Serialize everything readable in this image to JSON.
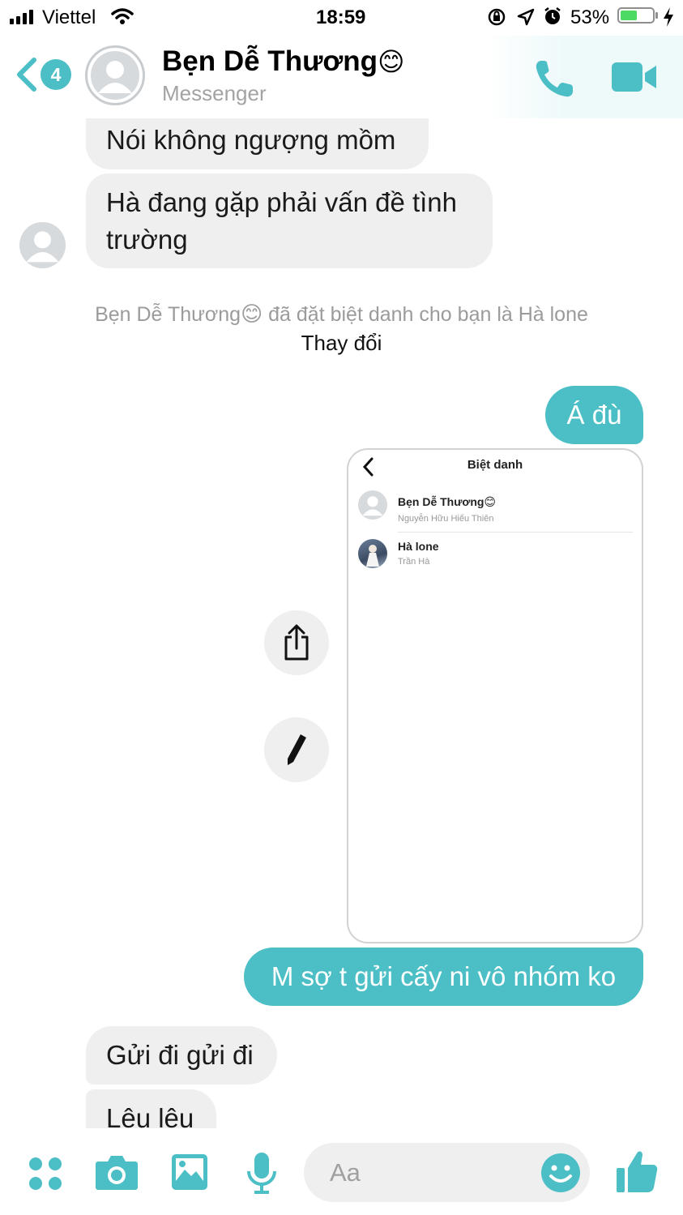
{
  "status_bar": {
    "carrier": "Viettel",
    "time": "18:59",
    "battery": "53%",
    "battery_level": 0.53
  },
  "header": {
    "back_badge": "4",
    "name": "Bẹn Dễ Thương",
    "name_emoji": "😊",
    "subtitle": "Messenger"
  },
  "messages": {
    "m1": "Nói không ngượng mồm",
    "m2_line1": "Hà đang gặp phải vấn đề tình",
    "m2_line2": "trường",
    "system_name": "Bẹn Dễ Thương",
    "system_emoji": "😊",
    "system_text": "đã đặt biệt danh cho bạn là Hà lone",
    "system_action": "Thay đổi",
    "out1": "Á đù",
    "out2": "M sợ t gửi cấy ni vô nhóm ko",
    "in3": "Gửi đi gửi đi",
    "in4": "Lêu lêu"
  },
  "shared_screenshot": {
    "title": "Biệt danh",
    "entries": [
      {
        "nickname": "Bẹn Dễ Thương",
        "emoji": "😊",
        "real_name": "Nguyễn Hữu Hiếu Thiên"
      },
      {
        "nickname": "Hà lone",
        "real_name": "Trần Hà"
      }
    ]
  },
  "composer": {
    "placeholder": "Aa"
  },
  "colors": {
    "accent": "#4bbfc5",
    "bubble_in": "#efefef",
    "system_text": "#9b9b9b"
  }
}
